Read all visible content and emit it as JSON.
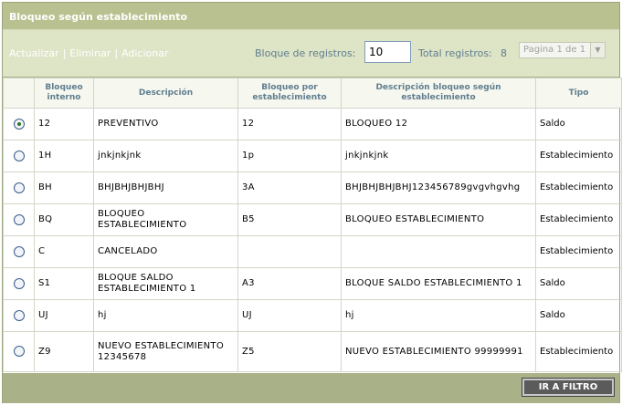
{
  "window": {
    "title": "Bloqueo según establecimiento"
  },
  "toolbar": {
    "actions": [
      "Actualizar",
      "Eliminar",
      "Adicionar"
    ],
    "block_label": "Bloque de registros:",
    "block_value": "10",
    "total_label": "Total registros:",
    "total_value": "8",
    "page_select": "Pagina 1 de 1"
  },
  "table": {
    "columns": [
      "",
      "Bloqueo interno",
      "Descripción",
      "Bloqueo por establecimiento",
      "Descripción bloqueo según establecimiento",
      "Tipo"
    ],
    "rows": [
      {
        "selected": true,
        "interno": "12",
        "descripcion": "PREVENTIVO",
        "bloqueo_est": "12",
        "desc_est": "BLOQUEO 12",
        "tipo": "Saldo"
      },
      {
        "selected": false,
        "interno": "1H",
        "descripcion": "jnkjnkjnk",
        "bloqueo_est": "1p",
        "desc_est": "jnkjnkjnk",
        "tipo": "Establecimiento"
      },
      {
        "selected": false,
        "interno": "BH",
        "descripcion": "BHJBHJBHJBHJ",
        "bloqueo_est": "3A",
        "desc_est": "BHJBHJBHJBHJ123456789gvgvhgvhg",
        "tipo": "Establecimiento"
      },
      {
        "selected": false,
        "interno": "BQ",
        "descripcion": "BLOQUEO ESTABLECIMIENTO",
        "bloqueo_est": "B5",
        "desc_est": "BLOQUEO ESTABLECIMIENTO",
        "tipo": "Establecimiento"
      },
      {
        "selected": false,
        "interno": "C",
        "descripcion": "CANCELADO",
        "bloqueo_est": "",
        "desc_est": "",
        "tipo": "Establecimiento"
      },
      {
        "selected": false,
        "interno": "S1",
        "descripcion": "BLOQUE SALDO ESTABLECIMIENTO 1",
        "bloqueo_est": "A3",
        "desc_est": "BLOQUE SALDO ESTABLECIMIENTO 1",
        "tipo": "Saldo"
      },
      {
        "selected": false,
        "interno": "UJ",
        "descripcion": "hj",
        "bloqueo_est": "UJ",
        "desc_est": "hj",
        "tipo": "Saldo"
      },
      {
        "selected": false,
        "interno": "Z9",
        "descripcion": "NUEVO ESTABLECIMIENTO 12345678",
        "bloqueo_est": "Z5",
        "desc_est": "NUEVO ESTABLECIMIENTO 99999991",
        "tipo": "Establecimiento"
      }
    ]
  },
  "footer": {
    "filter_button": "IR A FILTRO"
  },
  "colors": {
    "title_bar": "#b8c18f",
    "toolbar": "#dee4c6",
    "footer": "#a9b189",
    "header_text": "#5f7e8f"
  }
}
